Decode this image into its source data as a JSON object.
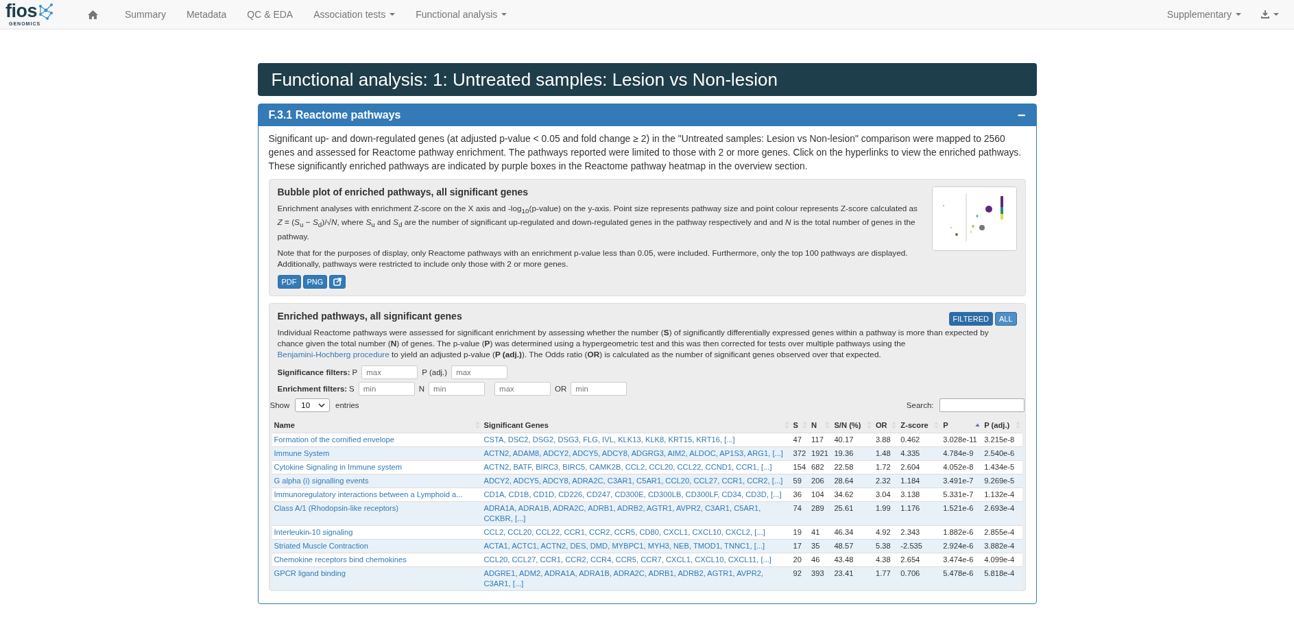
{
  "navbar": {
    "logo": {
      "word": "fios",
      "sub": "GENOMICS"
    },
    "items": [
      {
        "label": "Summary",
        "dropdown": false
      },
      {
        "label": "Metadata",
        "dropdown": false
      },
      {
        "label": "QC & EDA",
        "dropdown": false
      },
      {
        "label": "Association tests",
        "dropdown": true
      },
      {
        "label": "Functional analysis",
        "dropdown": true
      }
    ],
    "right": [
      {
        "label": "Supplementary",
        "dropdown": true
      }
    ]
  },
  "page_title": "Functional analysis: 1: Untreated samples: Lesion vs Non-lesion",
  "panel": {
    "title": "F.3.1 Reactome pathways",
    "collapse": "−",
    "intro": "Significant up- and down-regulated genes (at adjusted p-value < 0.05 and fold change ≥ 2) in the \"Untreated samples: Lesion vs Non-lesion\" comparison were mapped to 2560 genes and assessed for Reactome pathway enrichment. The pathways reported were limited to those with 2 or more genes. Click on the hyperlinks to view the enriched pathways. These significantly enriched pathways are indicated by purple boxes in the Reactome pathway heatmap in the overview section.",
    "bubble": {
      "title": "Bubble plot of enriched pathways, all significant genes",
      "paragraphs": [
        "Enrichment analyses with enrichment Z-score on the X axis and -log$_{10}$(p-value) on the y-axis. Point size represents pathway size and point colour represents Z-score calculated as *Z* = (*S*$_{u}$ − *S*$_{d}$)/√*N*, where *S*$_{u}$ and *S*$_{d}$ are the number of significant up-regulated and down-regulated genes in the pathway respectively and and *N* is the total number of genes in the pathway.",
        "Note that for the purposes of display, only Reactome pathways with an enrichment p-value less than 0.05, were included. Furthermore, only the top 100 pathways are displayed. Additionally, pathways were restricted to include only those with 2 or more genes."
      ],
      "buttons": [
        "PDF",
        "PNG"
      ]
    },
    "enriched": {
      "title": "Enriched pathways, all significant genes",
      "toggle": [
        {
          "label": "FILTERED",
          "selected": true
        },
        {
          "label": "ALL",
          "selected": false
        }
      ],
      "text_before": "Individual Reactome pathways were assessed for significant enrichment by assessing whether the number (**S**) of significantly differentially expressed genes within a pathway is more than expected by chance given the total number (**N**) of genes. The p-value (**P**) was determined using a hypergeometric test and this was then corrected for tests over multiple pathways using the",
      "link": "Benjamini-Hochberg procedure",
      "text_after": "to yield an adjusted p-value (**P (adj.)**). The Odds ratio (**OR**) is calculated as the number of significant genes observed over that expected.",
      "significance_filters": {
        "label": "Significance filters:",
        "fields": [
          {
            "label": "P",
            "placeholder": "max"
          },
          {
            "label": "P (adj.)",
            "placeholder": "max"
          }
        ]
      },
      "enrichment_filters": {
        "label": "Enrichment filters:",
        "fields": [
          {
            "label": "S",
            "placeholder": "min"
          },
          {
            "label": "N",
            "placeholder": "min"
          },
          {
            "placeholder": "max"
          },
          {
            "label": "OR",
            "placeholder": "min"
          }
        ]
      },
      "show": {
        "before": "Show",
        "value": "10",
        "after": "entries"
      },
      "search_label": "Search:",
      "columns": [
        {
          "label": "Name",
          "sorted": false
        },
        {
          "label": "Significant Genes",
          "sorted": false
        },
        {
          "label": "S",
          "sorted": false
        },
        {
          "label": "N",
          "sorted": false
        },
        {
          "label": "S/N (%)",
          "sorted": false
        },
        {
          "label": "OR",
          "sorted": false
        },
        {
          "label": "Z-score",
          "sorted": false
        },
        {
          "label": "P",
          "sorted": true
        },
        {
          "label": "P (adj.)",
          "sorted": false
        }
      ],
      "rows": [
        [
          "Formation of the cornified envelope",
          "CSTA, DSC2, DSG2, DSG3, FLG, IVL, KLK13, KLK8, KRT15, KRT16, [...]",
          "47",
          "117",
          "40.17",
          "3.88",
          "0.462",
          "3.028e-11",
          "3.215e-8"
        ],
        [
          "Immune System",
          "ACTN2, ADAM8, ADCY2, ADCY5, ADCY8, ADGRG3, AIM2, ALDOC, AP1S3, ARG1, [...]",
          "372",
          "1921",
          "19.36",
          "1.48",
          "4.335",
          "4.784e-9",
          "2.540e-6"
        ],
        [
          "Cytokine Signaling in Immune system",
          "ACTN2, BATF, BIRC3, BIRC5, CAMK2B, CCL2, CCL20, CCL22, CCND1, CCR1, [...]",
          "154",
          "682",
          "22.58",
          "1.72",
          "2.604",
          "4.052e-8",
          "1.434e-5"
        ],
        [
          "G alpha (i) signalling events",
          "ADCY2, ADCY5, ADCY8, ADRA2C, C3AR1, C5AR1, CCL20, CCL27, CCR1, CCR2, [...]",
          "59",
          "206",
          "28.64",
          "2.32",
          "1.184",
          "3.491e-7",
          "9.269e-5"
        ],
        [
          "Immunoregulatory interactions between a Lymphoid a...",
          "CD1A, CD1B, CD1D, CD226, CD247, CD300E, CD300LB, CD300LF, CD34, CD3D, [...]",
          "36",
          "104",
          "34.62",
          "3.04",
          "3.138",
          "5.331e-7",
          "1.132e-4"
        ],
        [
          "Class A/1 (Rhodopsin-like receptors)",
          "ADRA1A, ADRA1B, ADRA2C, ADRB1, ADRB2, AGTR1, AVPR2, C3AR1, C5AR1, CCKBR, [...]",
          "74",
          "289",
          "25.61",
          "1.99",
          "1.176",
          "1.521e-6",
          "2.693e-4"
        ],
        [
          "Interleukin-10 signaling",
          "CCL2, CCL20, CCL22, CCR1, CCR2, CCR5, CD80, CXCL1, CXCL10, CXCL2, [...]",
          "19",
          "41",
          "46.34",
          "4.92",
          "2.343",
          "1.882e-6",
          "2.855e-4"
        ],
        [
          "Striated Muscle Contraction",
          "ACTA1, ACTC1, ACTN2, DES, DMD, MYBPC1, MYH3, NEB, TMOD1, TNNC1, [...]",
          "17",
          "35",
          "48.57",
          "5.38",
          "-2.535",
          "2.924e-6",
          "3.882e-4"
        ],
        [
          "Chemokine receptors bind chemokines",
          "CCL20, CCL27, CCR1, CCR2, CCR4, CCR5, CCR7, CXCL1, CXCL10, CXCL11, [...]",
          "20",
          "46",
          "43.48",
          "4.38",
          "2.654",
          "3.474e-6",
          "4.099e-4"
        ],
        [
          "GPCR ligand binding",
          "ADGRE1, ADM2, ADRA1A, ADRA1B, ADRA2C, ADRB1, ADRB2, AGTR1, AVPR2, C3AR1, [...]",
          "92",
          "393",
          "23.41",
          "1.77",
          "0.706",
          "5.478e-6",
          "5.818e-4"
        ]
      ]
    }
  }
}
